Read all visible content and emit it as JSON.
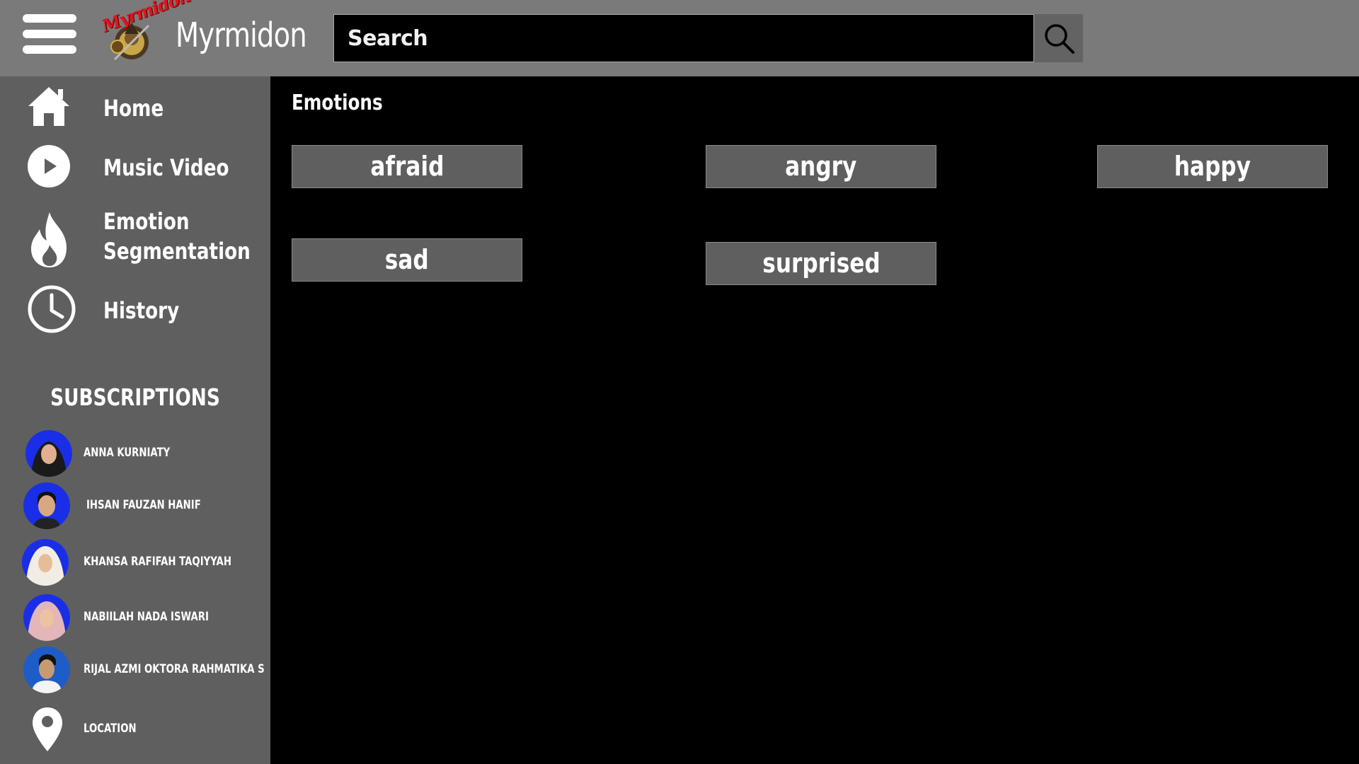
{
  "header": {
    "logo_script": "Myrmidon",
    "brand": "Myrmidon",
    "search_placeholder": "Search"
  },
  "sidebar": {
    "nav": [
      {
        "label": "Home",
        "icon": "home-icon"
      },
      {
        "label": "Music Video",
        "icon": "play-icon"
      },
      {
        "label_line1": "Emotion",
        "label_line2": "Segmentation",
        "icon": "fire-icon",
        "active": true
      },
      {
        "label": "History",
        "icon": "clock-icon"
      }
    ],
    "subscriptions_title": "SUBSCRIPTIONS",
    "subscriptions": [
      {
        "name": "ANNA KURNIATY"
      },
      {
        "name": "IHSAN FAUZAN HANIF"
      },
      {
        "name": "KHANSA RAFIFAH TAQIYYAH"
      },
      {
        "name": "NABIILAH NADA ISWARI"
      },
      {
        "name": "RIJAL AZMI OKTORA RAHMATIKA S"
      }
    ],
    "location_label": "LOCATION"
  },
  "main": {
    "title": "Emotions",
    "emotions": [
      "afraid",
      "angry",
      "happy",
      "sad",
      "surprised"
    ]
  },
  "colors": {
    "header_bg": "#7a7a7a",
    "sidebar_bg": "#5f5f5f",
    "main_bg": "#000000",
    "chip_bg": "#5f5f5f",
    "avatar_bg": "#1a2ee8"
  }
}
